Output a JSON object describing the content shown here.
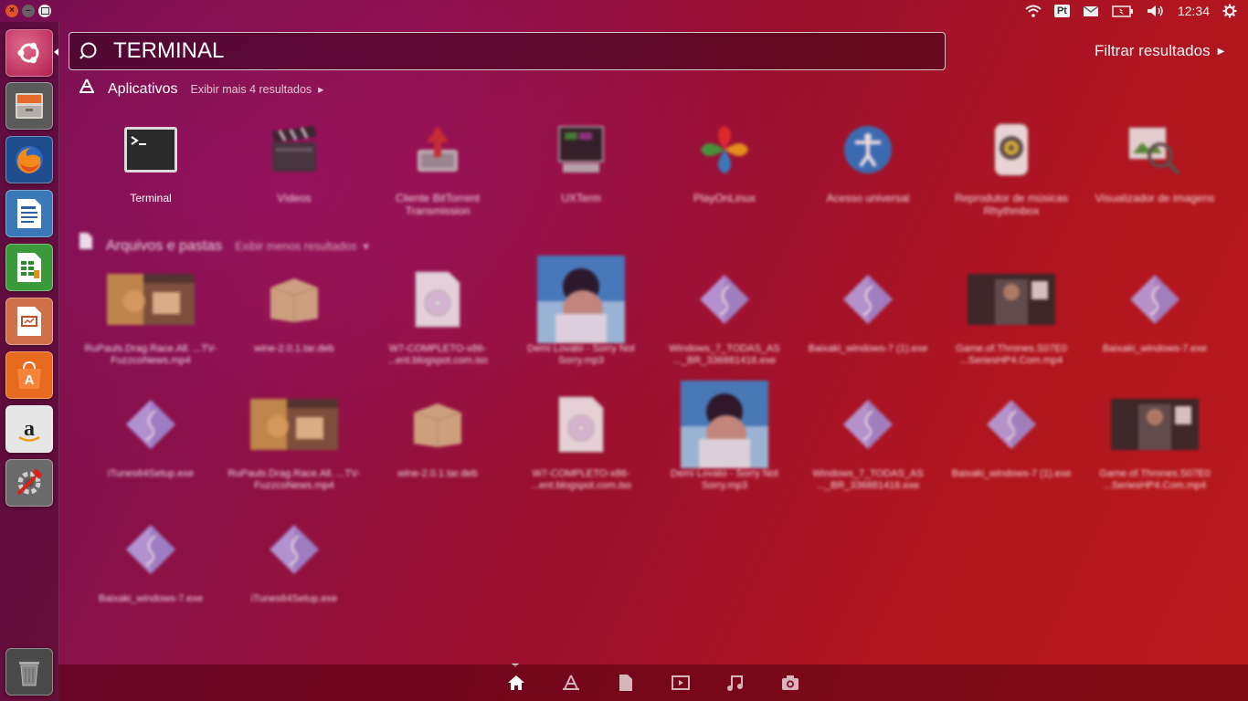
{
  "window_controls": {
    "close": "×",
    "minimize": "–",
    "maximize": "□"
  },
  "top_panel": {
    "keyboard_layout": "Pt",
    "time": "12:34"
  },
  "search": {
    "query": "TERMINAL"
  },
  "filter_results_label": "Filtrar resultados",
  "apps_section": {
    "title": "Aplicativos",
    "more": "Exibir mais 4 resultados",
    "items": [
      {
        "label": "Terminal",
        "icon": "terminal-icon"
      },
      {
        "label": "Vídeos",
        "icon": "video-clapper-icon"
      },
      {
        "label": "Cliente BitTorrent Transmission",
        "icon": "transmission-icon"
      },
      {
        "label": "UXTerm",
        "icon": "uxterm-icon"
      },
      {
        "label": "PlayOnLinux",
        "icon": "playonlinux-icon"
      },
      {
        "label": "Acesso universal",
        "icon": "accessibility-icon"
      },
      {
        "label": "Reprodutor de músicas Rhythmbox",
        "icon": "rhythmbox-icon"
      },
      {
        "label": "Visualizador de imagens",
        "icon": "image-viewer-icon"
      }
    ]
  },
  "files_section": {
    "title": "Arquivos e pastas",
    "more": "Exibir menos resultados",
    "items": [
      {
        "label": "RuPauls.Drag.Race.All. ...TV-FuzzcoNews.mp4",
        "type": "video-thumbnail"
      },
      {
        "label": "wine-2.0.1.tar.deb",
        "type": "package"
      },
      {
        "label": "W7-COMPLETO-x86- ...ent.blogspot.com.iso",
        "type": "disc-image"
      },
      {
        "label": "Demi Lovato - Sorry Not Sorry.mp3",
        "type": "album-art"
      },
      {
        "label": "Windows_7_TODAS_AS ..._BR_336881416.exe",
        "type": "executable"
      },
      {
        "label": "Baixaki_windows-7 (1).exe",
        "type": "executable"
      },
      {
        "label": "Game.of.Thrones.S07E0 ...SeriesHP4.Com.mp4",
        "type": "video-thumbnail-dark"
      },
      {
        "label": "Baixaki_windows-7.exe",
        "type": "executable"
      },
      {
        "label": "iTunes64Setup.exe",
        "type": "executable"
      },
      {
        "label": "RuPauls.Drag.Race.All. ...TV-FuzzcoNews.mp4",
        "type": "video-thumbnail"
      },
      {
        "label": "wine-2.0.1.tar.deb",
        "type": "package"
      },
      {
        "label": "W7-COMPLETO-x86- ...ent.blogspot.com.iso",
        "type": "disc-image"
      },
      {
        "label": "Demi Lovato - Sorry Not Sorry.mp3",
        "type": "album-art"
      },
      {
        "label": "Windows_7_TODAS_AS ..._BR_336881416.exe",
        "type": "executable"
      },
      {
        "label": "Baixaki_windows-7 (1).exe",
        "type": "executable"
      },
      {
        "label": "Game.of.Thrones.S07E0 ...SeriesHP4.Com.mp4",
        "type": "video-thumbnail-dark"
      },
      {
        "label": "Baixaki_windows-7.exe",
        "type": "executable"
      },
      {
        "label": "iTunes64Setup.exe",
        "type": "executable"
      }
    ]
  },
  "launcher_items": [
    "ubuntu-dash-icon",
    "files-icon",
    "firefox-icon",
    "writer-icon",
    "calc-icon",
    "impress-icon",
    "software-center-icon",
    "amazon-icon",
    "system-settings-icon",
    "trash-icon"
  ],
  "lenses": [
    "home-lens-icon",
    "applications-lens-icon",
    "files-lens-icon",
    "video-lens-icon",
    "music-lens-icon",
    "photo-lens-icon"
  ]
}
